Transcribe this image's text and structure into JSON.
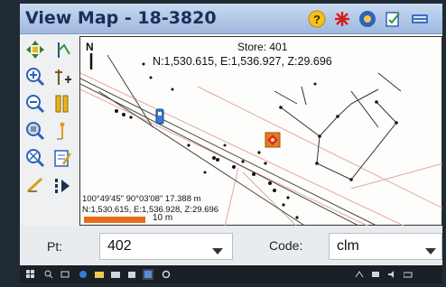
{
  "window": {
    "title": "View Map - 18-3820"
  },
  "titlebar_icons": [
    "help-icon",
    "stakeout-star-icon",
    "settings-gear-icon",
    "edit-check-icon",
    "keyboard-icon"
  ],
  "left_toolbar": [
    "pan-tool-icon",
    "survey-point-icon",
    "zoom-in-icon",
    "add-point-icon",
    "zoom-out-icon",
    "measure-icon",
    "zoom-window-icon",
    "rover-icon",
    "zoom-extents-icon",
    "notes-icon",
    "line-tool-icon",
    "play-next-icon"
  ],
  "map": {
    "north_label": "N",
    "store_label": "Store: 401",
    "coordinates": "N:1,530.615, E:1,536.927, Z:29.696",
    "angles": "100°49'45\" 90°03'08\" 17.388 m",
    "cursor_coordinates": "N:1,530.615, E:1,536.928, Z:29.696",
    "scale_label": "10 m"
  },
  "form": {
    "point_label": "Pt:",
    "point_value": "402",
    "code_label": "Code:",
    "code_value": "clm"
  },
  "taskbar": {
    "icons": [
      "windows-start-icon",
      "search-icon",
      "task-view-icon",
      "edge-icon",
      "file-explorer-icon",
      "mail-icon",
      "store-icon",
      "app-icon",
      "settings-icon"
    ]
  },
  "colors": {
    "title_text": "#1c2f55",
    "titlebar": "#b7cbe9",
    "scale_bar": "#e66d1a",
    "map_red_lines": "#e3a6a6"
  }
}
